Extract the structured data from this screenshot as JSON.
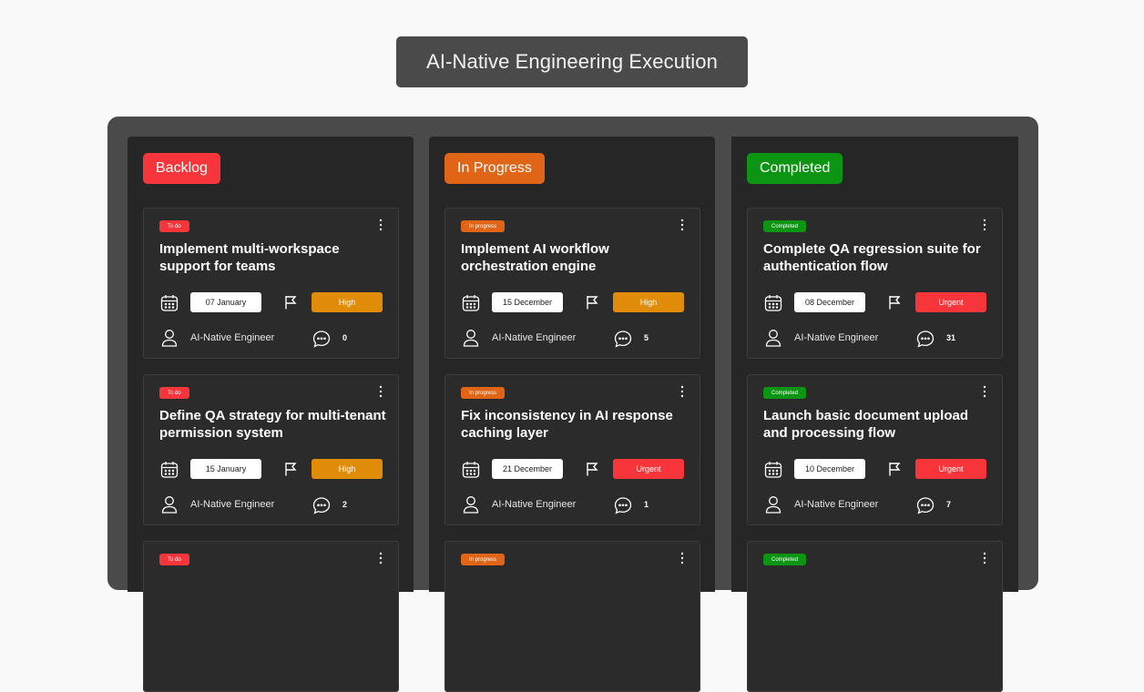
{
  "header": {
    "title": "AI-Native Engineering Execution"
  },
  "colors": {
    "backlog": "#f7353a",
    "in_progress": "#e06517",
    "completed": "#0c9512",
    "high": "#e08c09",
    "urgent": "#f7353a"
  },
  "columns": [
    {
      "label": "Backlog",
      "cards": [
        {
          "tag": "To do",
          "title": "Implement multi-workspace support for teams",
          "date": "07 January",
          "priority": "High",
          "assignee": "AI-Native Engineer",
          "comments": "0"
        },
        {
          "tag": "To do",
          "title": "Define QA strategy for multi-tenant permission system",
          "date": "15 January",
          "priority": "High",
          "assignee": "AI-Native Engineer",
          "comments": "2"
        },
        {
          "tag": "To do"
        }
      ]
    },
    {
      "label": "In Progress",
      "cards": [
        {
          "tag": "In progress",
          "title": "Implement AI workflow orchestration engine",
          "date": "15 December",
          "priority": "High",
          "assignee": "AI-Native Engineer",
          "comments": "5"
        },
        {
          "tag": "In progress",
          "title": "Fix inconsistency in AI response caching layer",
          "date": "21 December",
          "priority": "Urgent",
          "assignee": "AI-Native Engineer",
          "comments": "1"
        },
        {
          "tag": "In progress"
        }
      ]
    },
    {
      "label": "Completed",
      "cards": [
        {
          "tag": "Completed",
          "title": "Complete QA regression suite for authentication flow",
          "date": "08 December",
          "priority": "Urgent",
          "assignee": "AI-Native Engineer",
          "comments": "31"
        },
        {
          "tag": "Completed",
          "title": "Launch basic document upload and processing flow",
          "date": "10 December",
          "priority": "Urgent",
          "assignee": "AI-Native Engineer",
          "comments": "7"
        },
        {
          "tag": "Completed"
        }
      ]
    }
  ]
}
